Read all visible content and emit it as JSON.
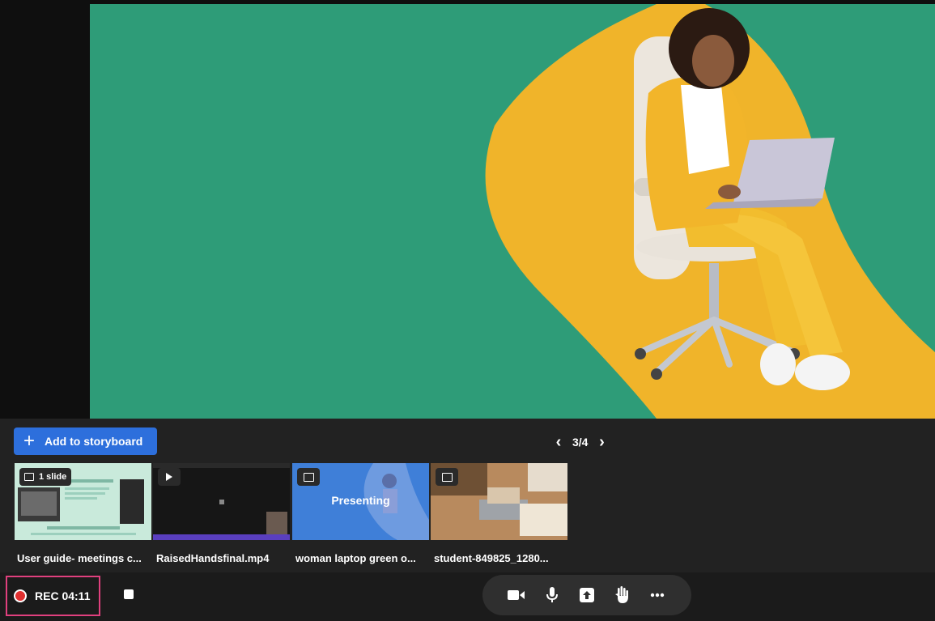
{
  "storyboard": {
    "add_label": "Add to storyboard",
    "page_indicator": "3/4"
  },
  "thumbnails": [
    {
      "badge_text": "1 slide",
      "badge_icon": "slide-icon",
      "label": "User guide- meetings c...",
      "preview_text": ""
    },
    {
      "badge_text": "",
      "badge_icon": "play-icon",
      "label": "RaisedHandsfinal.mp4",
      "preview_text": ""
    },
    {
      "badge_text": "",
      "badge_icon": "image-icon",
      "label": "woman laptop green o...",
      "preview_text": "Presenting"
    },
    {
      "badge_text": "",
      "badge_icon": "image-icon",
      "label": "student-849825_1280...",
      "preview_text": ""
    }
  ],
  "recording": {
    "label": "REC 04:11"
  },
  "controls": [
    "camera-icon",
    "microphone-icon",
    "share-screen-icon",
    "raise-hand-icon",
    "more-icon"
  ],
  "colors": {
    "slide_bg": "#2e9c78",
    "accent_blue": "#2d6fdc",
    "rec_border": "#e0407e",
    "rec_dot": "#e03030",
    "swoosh": "#f0b42a"
  }
}
